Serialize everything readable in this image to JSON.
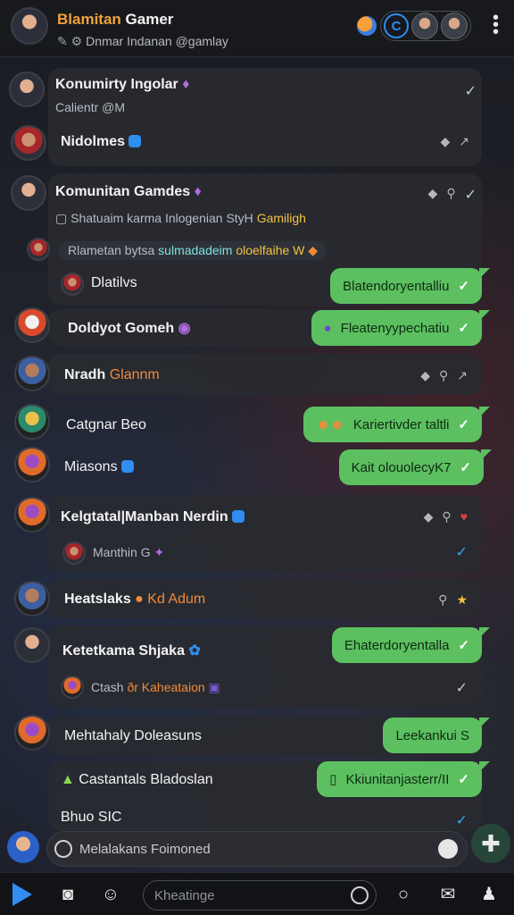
{
  "header": {
    "title_prefix": "Blamitan",
    "title_rest": " Gamer",
    "subtitle": "Dnmar Indanan @gamlay",
    "more_label": "⋮"
  },
  "chats": [
    {
      "name": "Konumirty Ingolar",
      "sub": "Calientr @M"
    },
    {
      "name": "Nidolmes"
    },
    {
      "name": "Komunitan Gamdes",
      "sub": "Shatuaim karma Inlogenian StyH",
      "sub_accent": "Gamiligh",
      "sub2": "Rlametan bytsa",
      "sub2_accent": " sulmadadeim",
      "sub2_tail": " oloelfaihe W"
    },
    {
      "name": "Dlatilvs",
      "bubble": "Blatendoryentalliu"
    },
    {
      "name": "Doldyot Gomeh",
      "bubble": "Fleatenyypechatiu"
    },
    {
      "name": "Nradh",
      "name_accent": "Glannm"
    },
    {
      "name": "Catgnar Beo",
      "bubble": "Kariertivder taltli"
    },
    {
      "name": "Miasons",
      "bubble": "Kait olouolecyK7"
    },
    {
      "name": "Kelgtatal|Manban Nerdin",
      "sub": "Manthin G"
    },
    {
      "name": "Heatslaks",
      "name_accent": "Kd Adum"
    },
    {
      "name": "Ketetkama Shjaka",
      "bubble": "Ehaterdoryentalla",
      "sub": "Ctash",
      "sub_accent": " ðr Kaheataion"
    },
    {
      "name": "Mehtahaly Doleasuns",
      "bubble": "Leekankui S"
    },
    {
      "name": "Castantals Bladoslan",
      "bubble": "Kkiunitanjasterr/II"
    },
    {
      "name": "Bhuo SIC"
    }
  ],
  "compose": {
    "placeholder": "Melalakans Foimoned"
  },
  "bottom": {
    "search_placeholder": "Kheatinge"
  },
  "colors": {
    "accent": "#5cc060",
    "link": "#2f8ef0",
    "orange": "#f08a3a"
  }
}
